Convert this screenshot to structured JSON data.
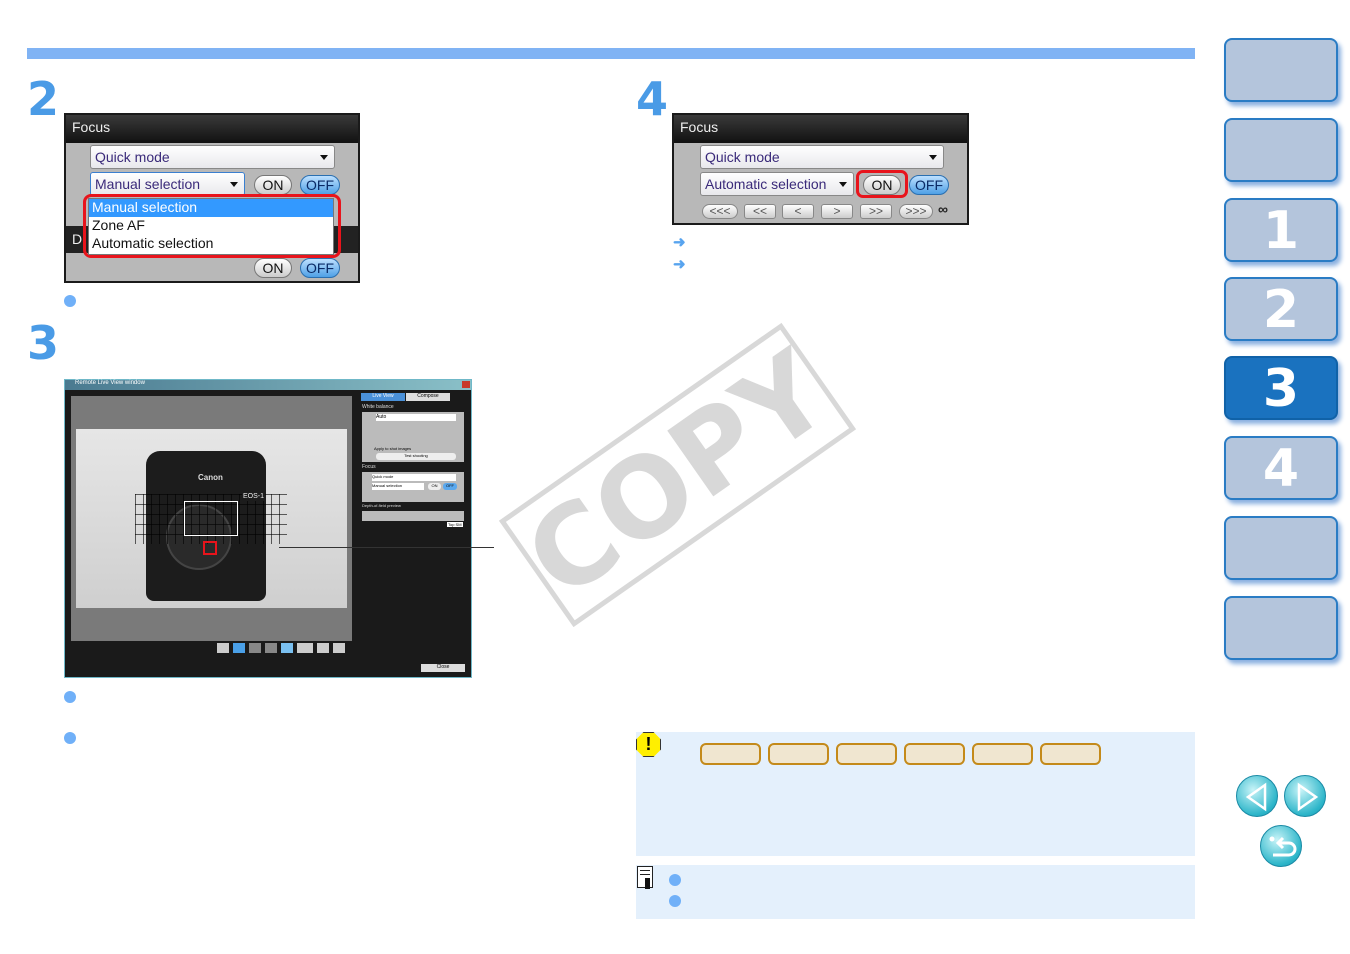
{
  "steps": {
    "s2": "2",
    "s3": "3",
    "s4": "4"
  },
  "panel_left": {
    "header": "Focus",
    "mode_select": "Quick mode",
    "af_select": "Manual selection",
    "on_label": "ON",
    "off_label": "OFF",
    "options": [
      "Manual selection",
      "Zone AF",
      "Automatic selection"
    ],
    "hidden_header": "D",
    "bottom_on": "ON",
    "bottom_off": "OFF"
  },
  "panel_right": {
    "header": "Focus",
    "mode_select": "Quick mode",
    "af_select": "Automatic selection",
    "on_label": "ON",
    "off_label": "OFF",
    "nav_buttons": [
      "<<<",
      "<<",
      "<",
      ">",
      ">>",
      ">>>"
    ],
    "infinity": "∞"
  },
  "live_view": {
    "window_title": "Remote Live View window",
    "tabs": [
      "Live View",
      "Compose"
    ],
    "wb_header": "White balance",
    "wb_select": "Auto",
    "apply_checkbox": "Apply to shot images",
    "test_shooting": "Test shooting",
    "focus_header": "Focus",
    "focus_mode": "Quick mode",
    "focus_af": "Manual selection",
    "on": "ON",
    "off": "OFF",
    "dof_header": "Depth-of-field preview",
    "topsm": "Top SM",
    "close": "Close",
    "camera_brand": "Canon",
    "camera_model": "EOS-1"
  },
  "watermark": "COPY",
  "side_tabs": [
    "",
    "",
    "1",
    "2",
    "3",
    "4",
    "",
    ""
  ],
  "active_tab": "3",
  "colors": {
    "accent": "#80b3f4",
    "tab_active": "#1a72bf",
    "tab": "#b4c5dc",
    "note_bg": "#e4f0fc",
    "highlight_red": "#e8141c"
  }
}
